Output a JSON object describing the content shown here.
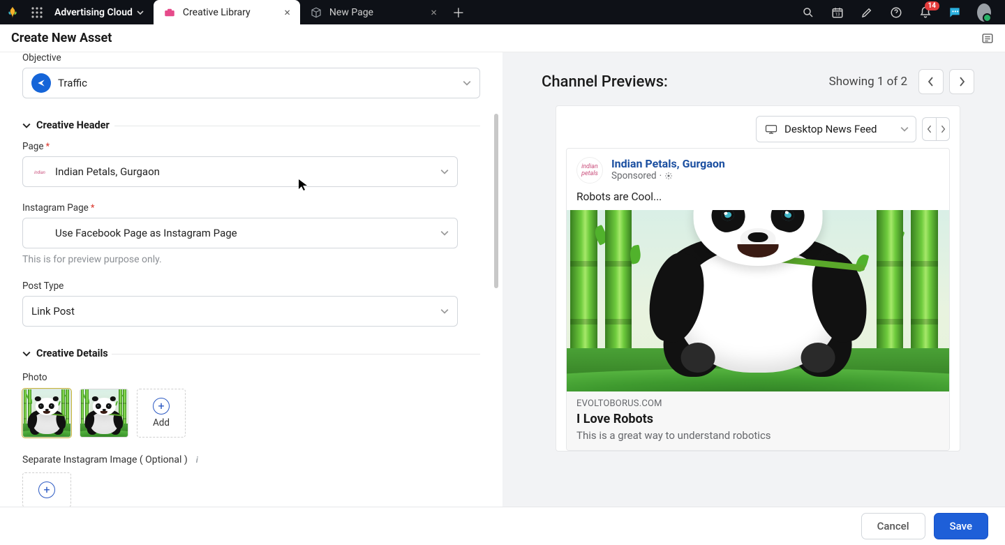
{
  "top": {
    "workspace": "Advertising Cloud",
    "tabs": [
      {
        "label": "Creative Library",
        "active": true
      },
      {
        "label": "New Page",
        "active": false
      }
    ],
    "notif_count": "14"
  },
  "header": {
    "title": "Create New Asset"
  },
  "form": {
    "objective_label": "Objective",
    "objective_value": "Traffic",
    "section_header": "Creative Header",
    "page_label": "Page",
    "page_value": "Indian Petals, Gurgaon",
    "insta_label": "Instagram Page",
    "insta_value": "Use Facebook Page as Instagram Page",
    "insta_hint": "This is for preview purpose only.",
    "posttype_label": "Post Type",
    "posttype_value": "Link Post",
    "section_details": "Creative Details",
    "photo_label": "Photo",
    "add_label": "Add",
    "separate_label": "Separate Instagram Image ( Optional )"
  },
  "preview": {
    "title": "Channel Previews:",
    "showing": "Showing 1 of 2",
    "device": "Desktop News Feed",
    "post": {
      "page_name": "Indian Petals, Gurgaon",
      "sponsored": "Sponsored",
      "body": "Robots are Cool...",
      "domain": "EVOLTOBORUS.COM",
      "headline": "I Love Robots",
      "desc": "This is a great way to understand robotics"
    }
  },
  "footer": {
    "cancel": "Cancel",
    "save": "Save"
  }
}
